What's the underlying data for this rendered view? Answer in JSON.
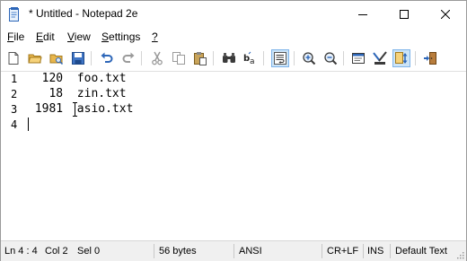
{
  "window": {
    "title": "* Untitled - Notepad 2e"
  },
  "menu": {
    "file": {
      "mnemonic": "F",
      "rest": "ile"
    },
    "edit": {
      "mnemonic": "E",
      "rest": "dit"
    },
    "view": {
      "mnemonic": "V",
      "rest": "iew"
    },
    "settings": {
      "mnemonic": "S",
      "rest": "ettings"
    },
    "help": {
      "mnemonic": "?",
      "rest": ""
    }
  },
  "toolbar": {
    "buttons": [
      "new-file",
      "open-file",
      "browse",
      "save",
      "undo",
      "redo",
      "cut",
      "copy",
      "paste",
      "find",
      "replace",
      "word-wrap",
      "zoom-in",
      "zoom-out",
      "scheme",
      "customize-scheme",
      "always-on-top",
      "exit"
    ],
    "active": "word-wrap"
  },
  "editor": {
    "line_numbers": [
      "1",
      "2",
      "3",
      "4"
    ],
    "lines": [
      "  120  foo.txt",
      "   18  zin.txt",
      " 1981  asio.txt",
      ""
    ]
  },
  "status": {
    "position": "Ln 4 : 4",
    "column": "Col 2",
    "selection": "Sel 0",
    "size": "56 bytes",
    "encoding": "ANSI",
    "line_ending": "CR+LF",
    "insert_mode": "INS",
    "lexer": "Default Text"
  },
  "colors": {
    "accent": "#1e6fd0",
    "active_button_bg": "#cce4f7",
    "status_bg": "#f0f0f0"
  }
}
